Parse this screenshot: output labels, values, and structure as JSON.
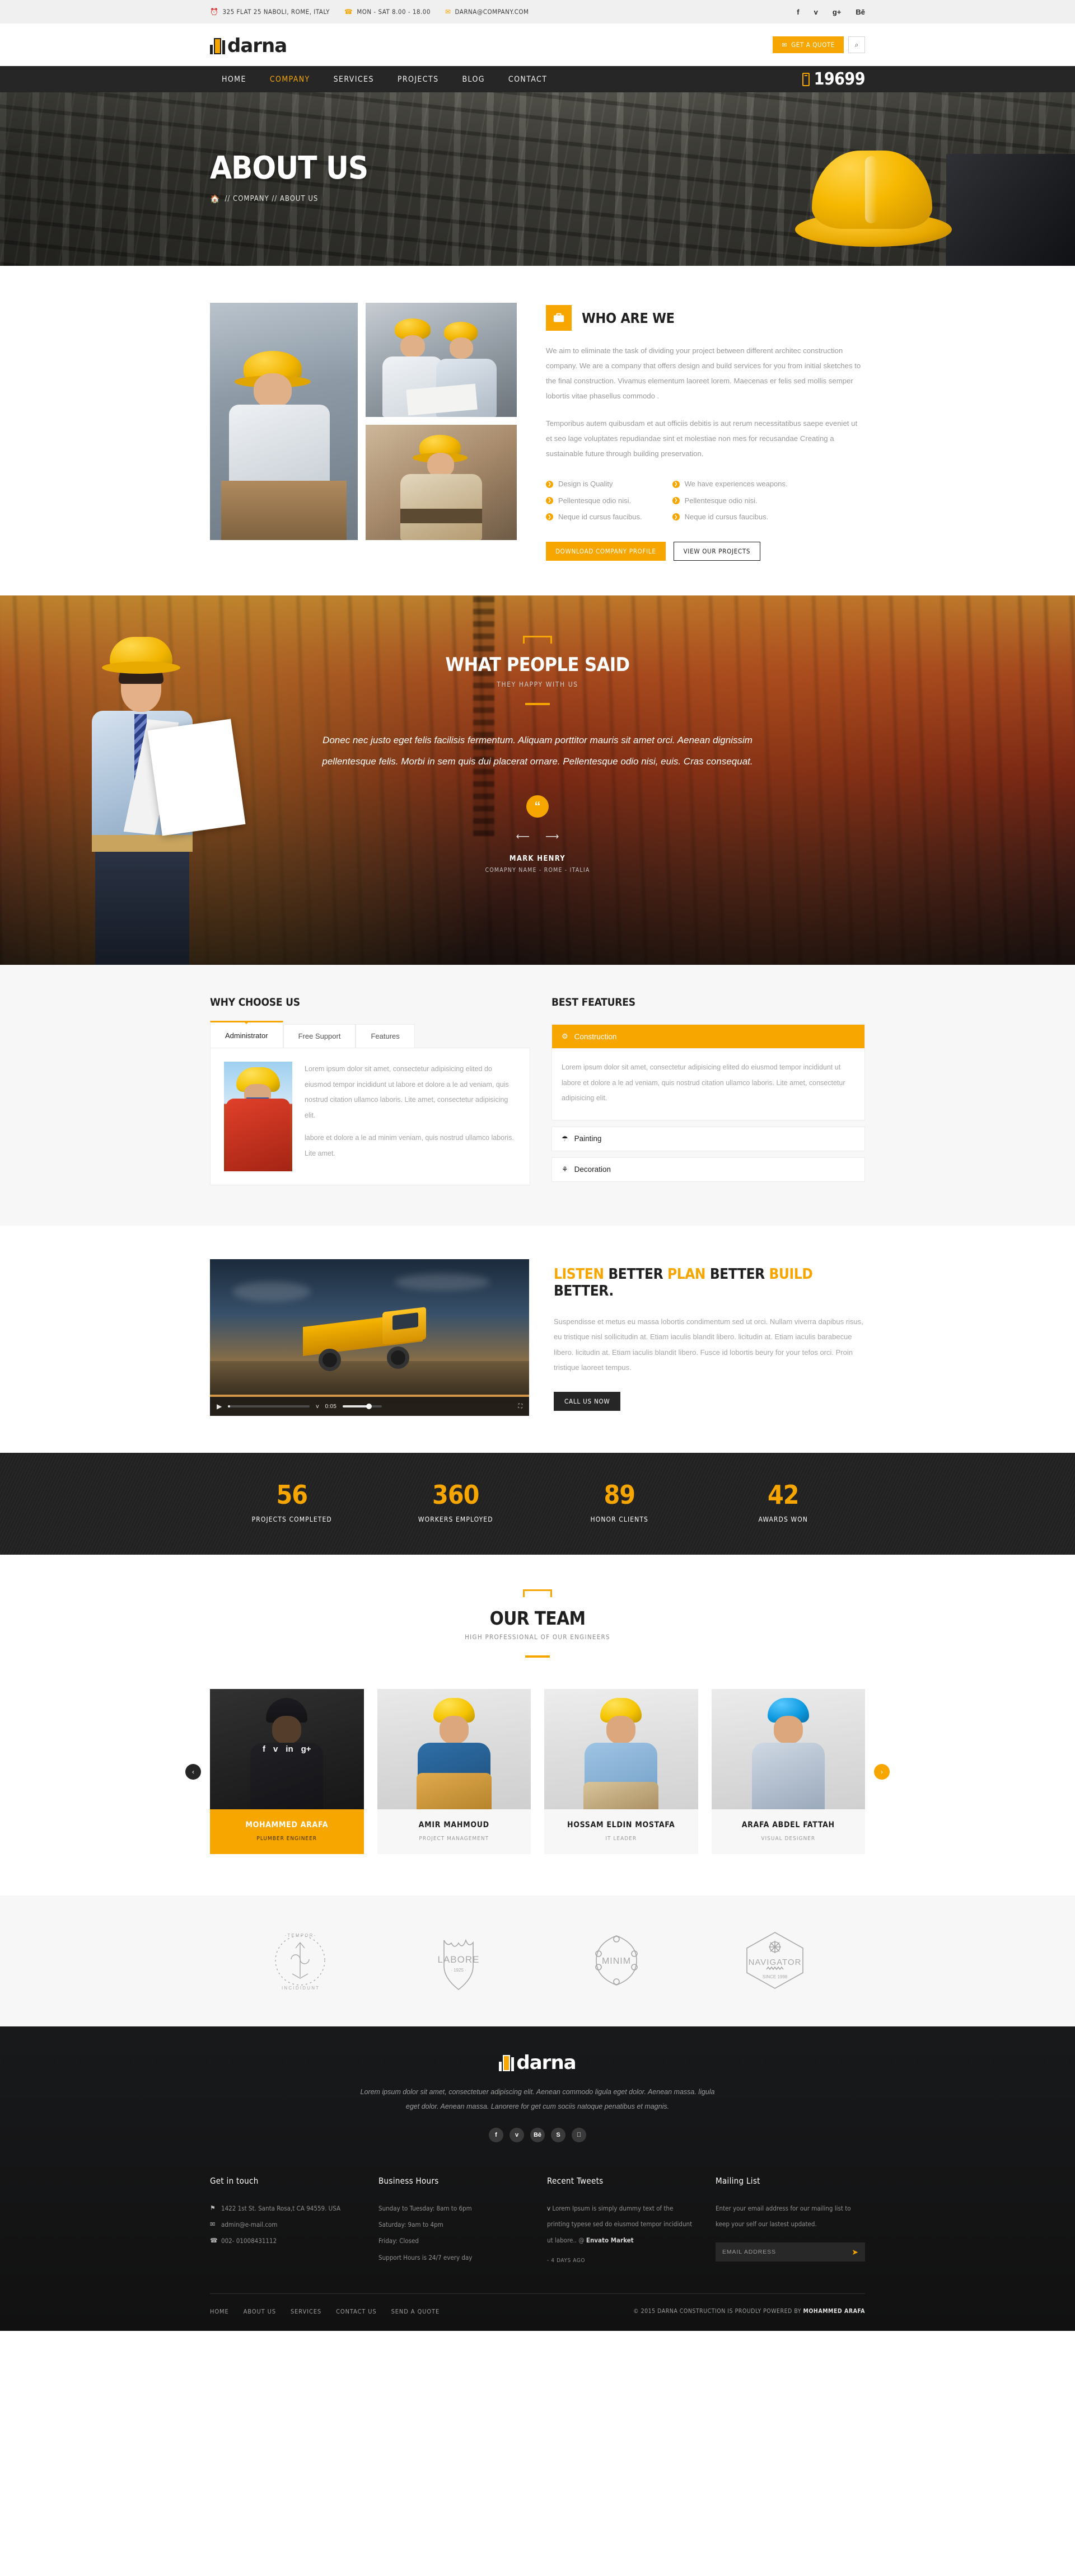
{
  "topbar": {
    "address": "325 FLAT 25 NABOLI, ROME, ITALY",
    "hours": "MON - SAT 8.00 - 18.00",
    "email": "DARNA@COMPANY.COM",
    "social": [
      {
        "name": "facebook-icon",
        "glyph": "f"
      },
      {
        "name": "twitter-icon",
        "glyph": "ᴠ"
      },
      {
        "name": "google-plus-icon",
        "glyph": "g+"
      },
      {
        "name": "behance-icon",
        "glyph": "Bē"
      }
    ]
  },
  "header": {
    "brand": "darna",
    "quote_button": "GET A QUOTE",
    "search_icon": "⌕"
  },
  "nav": {
    "items": [
      {
        "label": "HOME",
        "active": false
      },
      {
        "label": "COMPANY",
        "active": true
      },
      {
        "label": "SERVICES",
        "active": false
      },
      {
        "label": "PROJECTS",
        "active": false
      },
      {
        "label": "BLOG",
        "active": false
      },
      {
        "label": "CONTACT",
        "active": false
      }
    ],
    "phone": "19699"
  },
  "banner": {
    "title": "ABOUT US",
    "breadcrumb": "// COMPANY // ABOUT US"
  },
  "who": {
    "title": "WHO ARE WE",
    "p1": "We aim to eliminate the task of dividing your project between different architec  construction company. We are a company that offers design and build services for you from initial sketches to the final construction. Vivamus elementum laoreet lorem. Maecenas er felis sed mollis semper lobortis vitae phasellus commodo .",
    "p2": "Temporibus autem quibusdam et aut officiis debitis is aut rerum necessitatibus saepe eveniet ut et seo lage voluptates repudiandae sint et molestiae non mes  for recusandae Creating a sustainable future through building preservation.",
    "list_left": [
      "Design is  Quality",
      "Pellentesque odio nisi.",
      " Neque id cursus faucibus."
    ],
    "list_right": [
      "We have experiences weapons.",
      "Pellentesque odio nisi.",
      " Neque id cursus faucibus."
    ],
    "btn_primary": "DOWNLOAD COMPANY PROFILE",
    "btn_secondary": "VIEW OUR PROJECTS"
  },
  "testimonial": {
    "title": "WHAT PEOPLE SAID",
    "subtitle": "THEY HAPPY WITH US",
    "quote": "Donec nec justo eget felis facilisis fermentum. Aliquam porttitor mauris sit amet orci. Aenean dignissim pellentesque felis. Morbi in sem quis dui placerat ornare. Pellentesque odio nisi, euis. Cras consequat.",
    "quote_mark": "“",
    "author": "MARK HENRY",
    "author_role": "COMAPNY NAME - ROME - ITALIA",
    "prev_arrow": "⟵",
    "next_arrow": "⟶"
  },
  "why": {
    "title": "WHY CHOOSE US",
    "tabs": [
      {
        "label": "Administrator",
        "active": true
      },
      {
        "label": "Free Support",
        "active": false
      },
      {
        "label": "Features",
        "active": false
      }
    ],
    "panel_p1": "Lorem ipsum dolor sit amet, consectetur adipisicing elited do eiusmod tempor incididunt ut labore et dolore a le ad veniam, quis nostrud citation ullamco laboris. Lite amet, consectetur adipisicing elit.",
    "panel_p2": "labore et dolore a le ad minim veniam, quis nostrud  ullamco laboris. Lite amet."
  },
  "features": {
    "title": "BEST FEATURES",
    "items": [
      {
        "label": "Construction",
        "icon": "gear-icon",
        "glyph": "⚙",
        "open": true,
        "body": "Lorem ipsum dolor sit amet, consectetur adipisicing elited do eiusmod tempor incididunt ut labore et dolore a le ad veniam, quis nostrud citation ullamco laboris. Lite amet, consectetur adipisicing elit."
      },
      {
        "label": "Painting",
        "icon": "roller-icon",
        "glyph": "☂",
        "open": false,
        "body": ""
      },
      {
        "label": "Decoration",
        "icon": "pin-icon",
        "glyph": "⚘",
        "open": false,
        "body": ""
      }
    ]
  },
  "listen": {
    "title_parts": [
      {
        "text": "LISTEN ",
        "accent": true
      },
      {
        "text": "BETTER  ",
        "accent": false
      },
      {
        "text": "PLAN ",
        "accent": true
      },
      {
        "text": "BETTER  ",
        "accent": false
      },
      {
        "text": "BUILD ",
        "accent": true
      },
      {
        "text": "BETTER.",
        "accent": false
      }
    ],
    "title_plain": "LISTEN BETTER  PLAN BETTER  BUILD BETTER.",
    "body": "Suspendisse et metus eu massa lobortis condimentum sed ut orci. Nullam viverra dapibus risus, eu tristique nisl sollicitudin at. Etiam iaculis blandit libero. licitudin at. Etiam iaculis barabecue libero. licitudin at. Etiam iaculis blandit libero. Fusce id lobortis beury  for your tefos orci. Proin tristique laoreet tempus.",
    "button": "CALL US NOW",
    "video": {
      "play_icon": "▶",
      "time": "0:05",
      "volume_icon": "ᴠ",
      "fullscreen_icon": "⛶"
    }
  },
  "counters": [
    {
      "num": "56",
      "label": "PROJECTS COMPLETED"
    },
    {
      "num": "360",
      "label": "WORKERS EMPLOYED"
    },
    {
      "num": "89",
      "label": "HONOR CLIENTS"
    },
    {
      "num": "42",
      "label": "AWARDS WON"
    }
  ],
  "team": {
    "title": "OUR TEAM",
    "subtitle": "HIGH PROFESSIONAL OF OUR ENGINEERS",
    "prev": "‹",
    "next": "›",
    "members": [
      {
        "name": "MOHAMMED ARAFA",
        "role": "PLUMBER ENGINEER",
        "active": true,
        "social": [
          "f",
          "ᴠ",
          "in",
          "g+"
        ]
      },
      {
        "name": "AMIR MAHMOUD",
        "role": "PROJECT MANAGEMENT",
        "active": false,
        "social": []
      },
      {
        "name": "HOSSAM ELDIN MOSTAFA",
        "role": "IT LEADER",
        "active": false,
        "social": []
      },
      {
        "name": "ARAFA ABDEL FATTAH",
        "role": "VISUAL DESIGNER",
        "active": false,
        "social": []
      }
    ]
  },
  "clients": [
    {
      "name": "TEMPOR INCIDIDUNT",
      "top": "- T E M P O R -",
      "bottom": "I N C I D I D U N T"
    },
    {
      "name": "LABORE",
      "label": "LABORE",
      "year": "· 1925 ·"
    },
    {
      "name": "MINIM",
      "label": "MINIM",
      "year": ""
    },
    {
      "name": "NAVIGATOR",
      "label": "NAVIGATOR",
      "year": "SINCE 1998"
    }
  ],
  "footer": {
    "brand": "darna",
    "description": "Lorem ipsum dolor sit amet, consectetuer adipiscing elit. Aenean commodo ligula eget dolor. Aenean massa. ligula eget dolor. Aenean massa.  Lanorere for get cum sociis natoque penatibus et magnis.",
    "social": [
      {
        "name": "facebook-icon",
        "glyph": "f"
      },
      {
        "name": "twitter-icon",
        "glyph": "ᴠ"
      },
      {
        "name": "behance-icon",
        "glyph": "Bē"
      },
      {
        "name": "skype-icon",
        "glyph": "S"
      },
      {
        "name": "apple-icon",
        "glyph": ""
      }
    ],
    "get_in_touch": {
      "title": "Get in touch",
      "items": [
        {
          "icon": "location-icon",
          "glyph": "⚑",
          "text": "1422 1st St. Santa Rosa,t CA 94559. USA"
        },
        {
          "icon": "mail-icon",
          "glyph": "✉",
          "text": "admin@e-mail.com"
        },
        {
          "icon": "phone-icon",
          "glyph": "☎",
          "text": "002- 01008431112"
        }
      ]
    },
    "business_hours": {
      "title": "Business Hours",
      "items": [
        "Sunday to Tuesday: 8am to 6pm",
        "Saturday: 9am to 4pm",
        "Friday: Closed",
        "Support Hours is 24/7 every day"
      ]
    },
    "recent_tweets": {
      "title": "Recent Tweets",
      "icon": "twitter-icon",
      "glyph": "ᴠ",
      "text": "Lorem Ipsum is simply dummy text of the printing typese sed do eiusmod tempor incididunt ut labore.. @ ",
      "handle": "Envato Market",
      "ago": "- 4 DAYS AGO"
    },
    "mailing_list": {
      "title": "Mailing List",
      "text": "Enter your email address for our mailing list to keep your self our lastest updated.",
      "placeholder": "EMAIL ADDRESS",
      "submit_icon": "➤"
    },
    "bottom_links": [
      "HOME",
      "ABOUT US",
      "SERVICES",
      "CONTACT US",
      "SEND A QUOTE"
    ],
    "copyright_pre": "© 2015 DARNA CONSTRUCTION IS PROUDLY POWERED BY ",
    "copyright_name": "MOHAMMED ARAFA"
  }
}
